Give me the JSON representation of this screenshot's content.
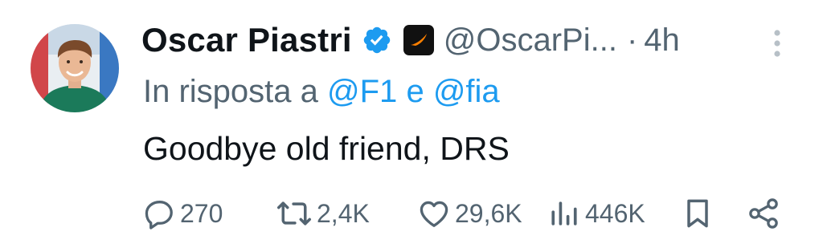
{
  "tweet": {
    "author_name": "Oscar Piastri",
    "handle": "@OscarPi...",
    "separator": "·",
    "time": "4h",
    "reply_prefix": "In risposta a",
    "reply_mention_1": "@F1",
    "reply_conjunction": "e",
    "reply_mention_2": "@fia",
    "text": "Goodbye old friend, DRS",
    "stats": {
      "replies": "270",
      "reposts": "2,4K",
      "likes": "29,6K",
      "views": "446K"
    }
  },
  "icons": {
    "verified": "verified-badge-icon",
    "affiliation": "mclaren-affiliation-icon",
    "more": "more-vertical-icon",
    "reply": "reply-icon",
    "repost": "repost-icon",
    "like": "heart-icon",
    "views": "views-icon",
    "bookmark": "bookmark-icon",
    "share": "share-icon"
  },
  "colors": {
    "text": "#0f1419",
    "secondary": "#536471",
    "link": "#1d9bf0",
    "verified": "#1d9bf0",
    "affiliation_accent": "#ff8000"
  }
}
